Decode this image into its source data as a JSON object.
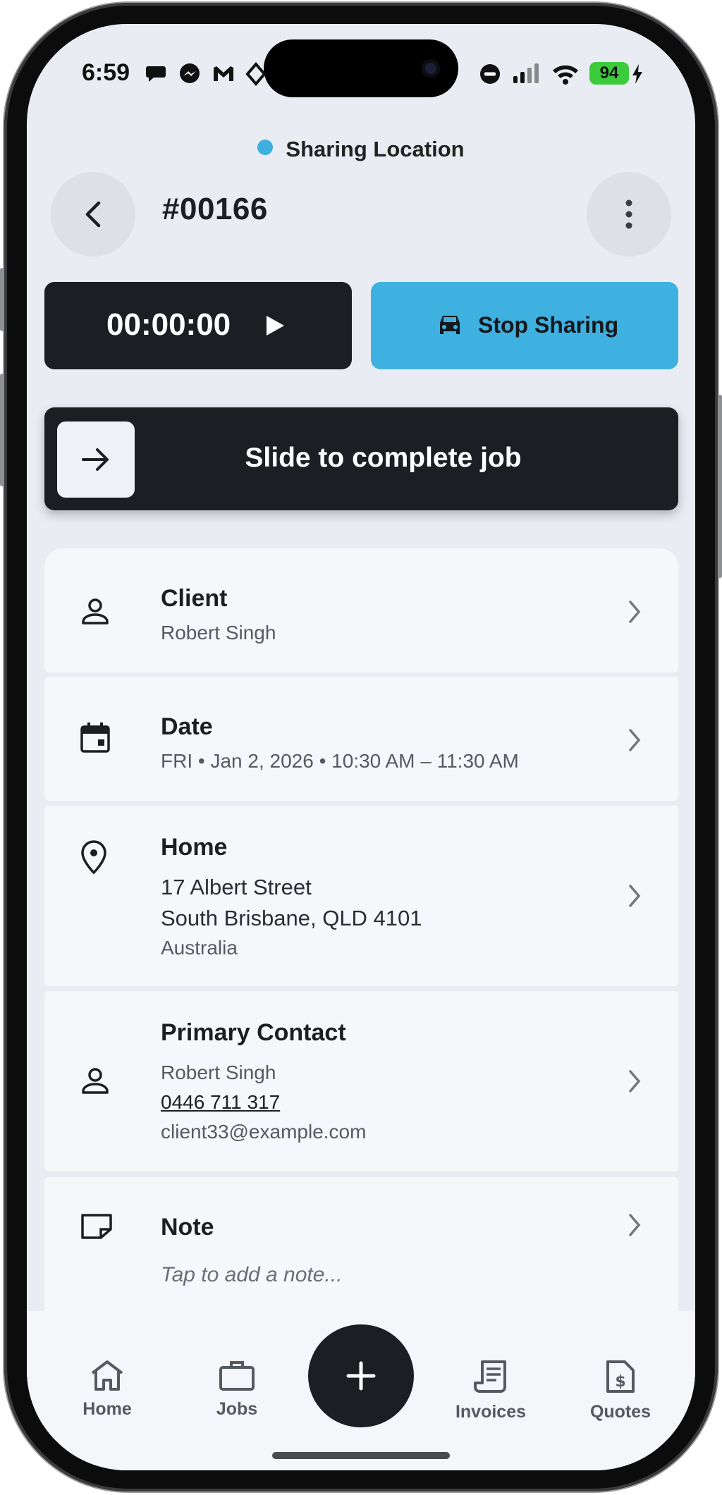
{
  "status_bar": {
    "time": "6:59",
    "battery": "94"
  },
  "banner": {
    "text": "Sharing Location",
    "dot_color": "#3fafdf"
  },
  "header": {
    "job_number": "#00166"
  },
  "actions": {
    "timer": "00:00:00",
    "stop_sharing": "Stop Sharing"
  },
  "slider": {
    "label": "Slide to complete job"
  },
  "cards": {
    "client": {
      "title": "Client",
      "name": "Robert Singh"
    },
    "date": {
      "title": "Date",
      "value": "FRI • Jan 2, 2026 • 10:30 AM – 11:30 AM"
    },
    "home": {
      "title": "Home",
      "line1": "17 Albert Street",
      "line2": "South Brisbane, QLD 4101",
      "country": "Australia"
    },
    "contact": {
      "title": "Primary Contact",
      "name": "Robert Singh",
      "phone": "0446 711 317",
      "email": "client33@example.com"
    },
    "note": {
      "title": "Note",
      "placeholder": "Tap to add a note..."
    }
  },
  "nav": {
    "home": "Home",
    "jobs": "Jobs",
    "invoices": "Invoices",
    "quotes": "Quotes"
  },
  "icons": {
    "back": "arrow-left-icon",
    "more": "more-vertical-icon",
    "play": "play-icon",
    "car": "car-icon",
    "arrow": "arrow-right-icon",
    "person": "person-icon",
    "calendar": "calendar-icon",
    "pin": "location-pin-icon",
    "note": "note-icon",
    "chevron": "chevron-right-icon",
    "add": "plus-icon"
  },
  "colors": {
    "accent": "#3fb1e0",
    "dark": "#1b1e22",
    "battery": "#3ccb3c"
  }
}
